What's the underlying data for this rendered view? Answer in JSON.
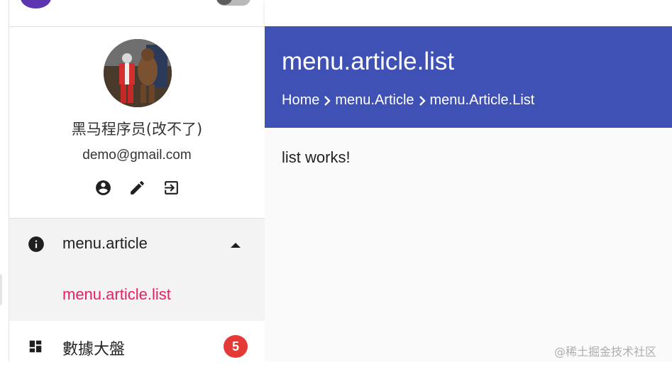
{
  "sidebar": {
    "user": {
      "name": "黑马程序员(改不了)",
      "email": "demo@gmail.com",
      "actions": [
        "account-circle-icon",
        "edit-pencil-icon",
        "logout-icon"
      ]
    },
    "menu": {
      "group": {
        "label": "menu.article",
        "icon": "info-icon",
        "expanded": true,
        "children": [
          {
            "label": "menu.article.list",
            "active": true
          }
        ]
      },
      "dashboard": {
        "label": "數據大盤",
        "icon": "dashboard-icon",
        "badge": "5"
      }
    }
  },
  "header": {
    "title": "menu.article.list",
    "breadcrumb": [
      "Home",
      "menu.Article",
      "menu.Article.List"
    ]
  },
  "content": {
    "text": "list works!"
  },
  "watermark": "@稀土掘金技术社区",
  "colors": {
    "header_bg": "#3f51b5",
    "active_link": "#e91e63",
    "badge": "#e53935",
    "logo": "#5e35b1"
  }
}
